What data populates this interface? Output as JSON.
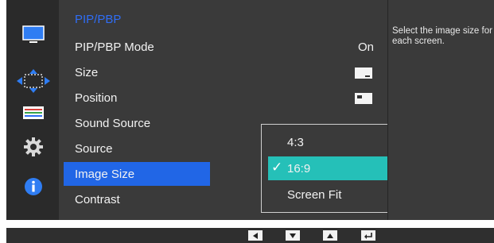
{
  "menu": {
    "title": "PIP/PBP",
    "items": [
      {
        "label": "PIP/PBP Mode",
        "value": "On"
      },
      {
        "label": "Size",
        "value": ""
      },
      {
        "label": "Position",
        "value": ""
      },
      {
        "label": "Sound Source",
        "value": ""
      },
      {
        "label": "Source",
        "value": ""
      },
      {
        "label": "Image Size",
        "value": "",
        "selected": true
      },
      {
        "label": "Contrast",
        "value": ""
      }
    ]
  },
  "dropdown": {
    "options": [
      "4:3",
      "16:9",
      "Screen Fit"
    ],
    "selected": "16:9"
  },
  "help": {
    "text": "Select the image size for each screen."
  },
  "sidebar": {
    "icons": [
      "monitor-icon",
      "move-arrows-icon",
      "color-bars-icon",
      "gear-icon",
      "info-icon"
    ]
  },
  "nav_buttons": [
    "left-arrow-icon",
    "down-arrow-icon",
    "up-arrow-icon",
    "enter-icon"
  ],
  "colors": {
    "highlight": "#2166e6",
    "active_option": "#25c0b8",
    "title": "#2f6df5"
  }
}
